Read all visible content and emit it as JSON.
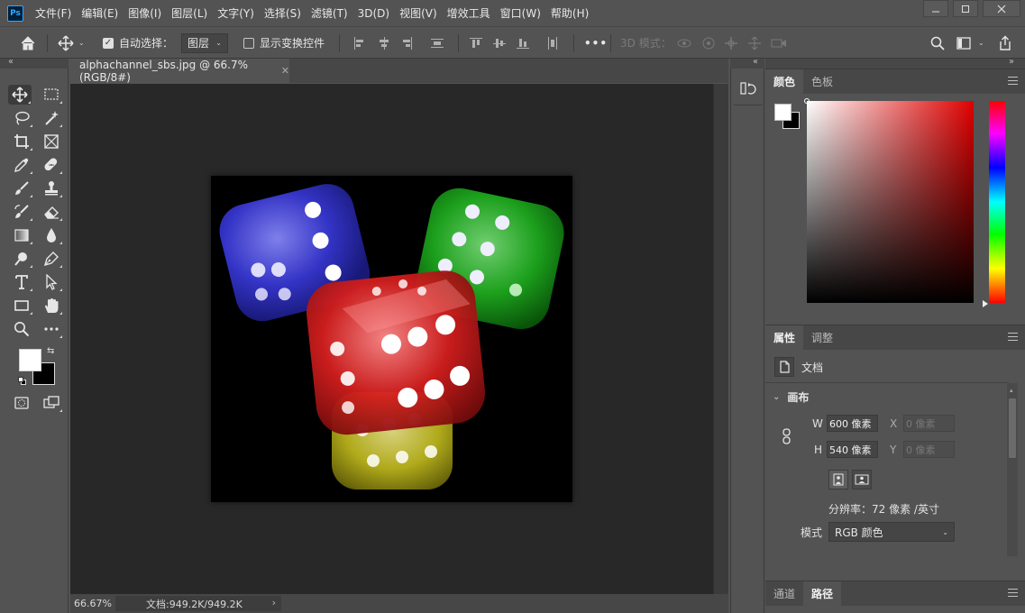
{
  "app": {
    "logo": "Ps"
  },
  "menu": [
    "文件(F)",
    "编辑(E)",
    "图像(I)",
    "图层(L)",
    "文字(Y)",
    "选择(S)",
    "滤镜(T)",
    "3D(D)",
    "视图(V)",
    "增效工具",
    "窗口(W)",
    "帮助(H)"
  ],
  "options_bar": {
    "auto_select_label": "自动选择：",
    "auto_select_checked": true,
    "auto_select_target": "图层",
    "show_transform_label": "显示变换控件",
    "show_transform_checked": false,
    "more_label": "•••",
    "mode_3d_label": "3D 模式："
  },
  "document": {
    "tab_title": "alphachannel_sbs.jpg @ 66.7%(RGB/8#)",
    "zoom": "66.67%",
    "doc_size": "文档:949.2K/949.2K",
    "dice_colors": [
      "#3b3bd6",
      "#1fb01f",
      "#c8c21e",
      "#d61f1f"
    ]
  },
  "color_panel": {
    "tabs": [
      "颜色",
      "色板"
    ],
    "active_tab": 0,
    "hue_color": "#e00000"
  },
  "properties_panel": {
    "tabs": [
      "属性",
      "调整"
    ],
    "active_tab": 0,
    "type_label": "文档",
    "section_title": "画布",
    "w_label": "W",
    "w_value": "600 像素",
    "h_label": "H",
    "h_value": "540 像素",
    "x_label": "X",
    "x_placeholder": "0 像素",
    "y_label": "Y",
    "y_placeholder": "0 像素",
    "resolution": "分辨率：72 像素 /英寸",
    "mode_label": "模式",
    "mode_value": "RGB 颜色"
  },
  "paths_panel": {
    "tabs": [
      "通道",
      "路径"
    ],
    "active_tab": 1
  }
}
